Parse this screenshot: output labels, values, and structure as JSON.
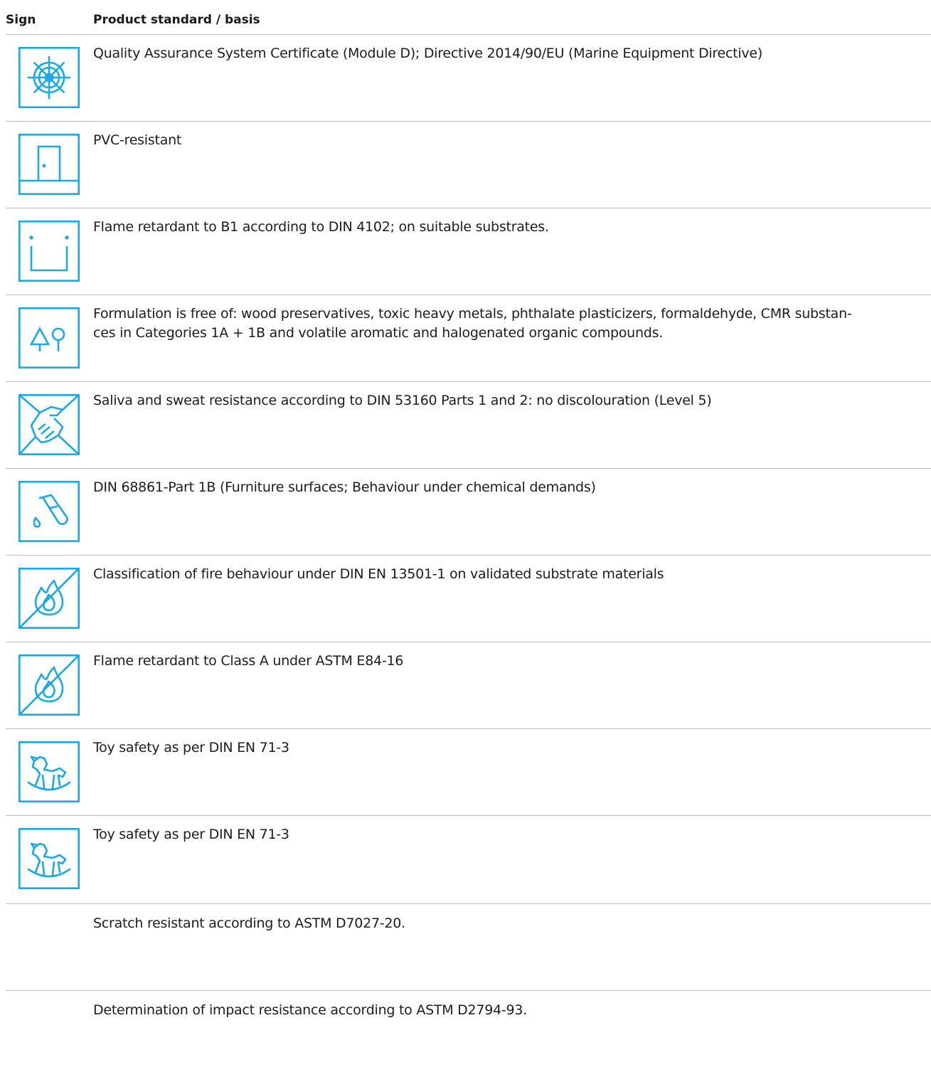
{
  "header": {
    "sign": "Sign",
    "basis": "Product standard / basis"
  },
  "accent_color": "#1aa9e0",
  "rows": [
    {
      "icon": "ship-wheel-icon",
      "text": "Quality Assurance System Certificate (Module D); Directive 2014/90/EU (Marine Equipment Directive)"
    },
    {
      "icon": "door-icon",
      "text": "PVC-resistant"
    },
    {
      "icon": "cup-icon",
      "text": "Flame retardant to B1 according to DIN 4102; on suitable substrates."
    },
    {
      "icon": "trees-icon",
      "text": "Formulation is free of: wood preservatives, toxic heavy metals, phthalate plasticizers, formaldehyde, CMR substan-\nces in Categories 1A + 1B and volatile aromatic and halogenated organic compounds."
    },
    {
      "icon": "handshake-icon",
      "text": "Saliva and sweat resistance according to DIN 53160 Parts 1 and 2: no discolouration (Level 5)"
    },
    {
      "icon": "test-tube-icon",
      "text": "DIN 68861-Part 1B (Furniture surfaces; Behaviour under chemical demands)"
    },
    {
      "icon": "no-fire-icon",
      "text": "Classification of fire behaviour under DIN EN 13501-1 on validated substrate materials"
    },
    {
      "icon": "no-fire-icon",
      "text": "Flame retardant to Class A under ASTM E84-16"
    },
    {
      "icon": "rocking-horse-icon",
      "text": "Toy safety as per DIN EN 71-3"
    },
    {
      "icon": "rocking-horse-icon",
      "text": "Toy safety as per DIN EN 71-3"
    },
    {
      "icon": "",
      "text": "Scratch resistant according to ASTM D7027-20."
    },
    {
      "icon": "",
      "text": "Determination of impact resistance according to ASTM D2794-93."
    }
  ]
}
